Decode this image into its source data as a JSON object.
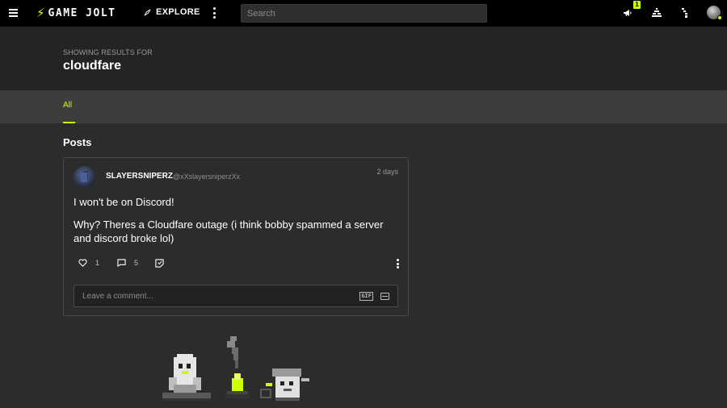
{
  "topbar": {
    "logo_text": "GAME JOLT",
    "explore_label": "EXPLORE",
    "search_placeholder": "Search",
    "notification_count": "1",
    "accent_color": "#ccff00"
  },
  "header": {
    "showing_label": "SHOWING RESULTS FOR",
    "query": "cloudfare"
  },
  "tabs": [
    {
      "label": "All",
      "active": true
    }
  ],
  "posts_section": {
    "title": "Posts",
    "posts": [
      {
        "author": "SLAYERSNIPERZ",
        "handle": "@xXslayersniperzXx",
        "time": "2 days",
        "paragraphs": [
          "I won't be on Discord!",
          "Why? Theres a Cloudfare outage (i think bobby spammed a server and discord broke lol)"
        ],
        "likes": "1",
        "comments": "5",
        "comment_placeholder": "Leave a comment...",
        "gif_label": "GIF"
      }
    ]
  },
  "icons": {
    "menu": "hamburger-icon",
    "explore": "compass-icon",
    "notifications": "megaphone-icon",
    "activity": "activity-icon",
    "trophies": "tree-icon",
    "like": "heart-icon",
    "comment": "comment-icon",
    "share": "sticker-icon"
  }
}
